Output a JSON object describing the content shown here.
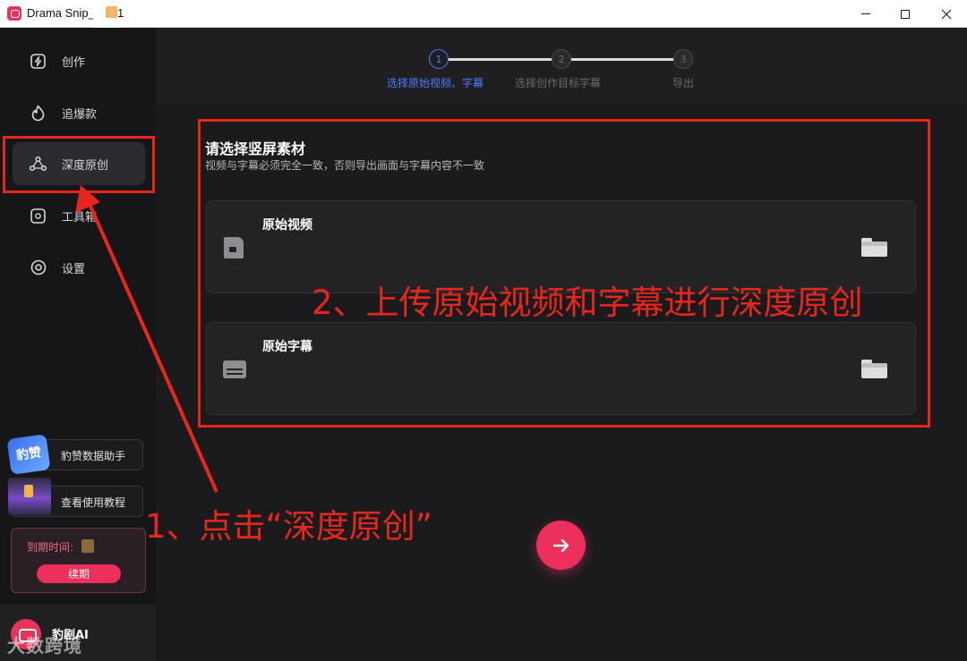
{
  "window": {
    "title": "Drama Snip_",
    "title_suffix": "1",
    "min_label": "minimize",
    "max_label": "maximize",
    "close_label": "close"
  },
  "sidebar": {
    "items": [
      {
        "label": "创作",
        "icon": "lightning-icon"
      },
      {
        "label": "追爆款",
        "icon": "flame-icon"
      },
      {
        "label": "深度原创",
        "icon": "network-icon"
      },
      {
        "label": "工具箱",
        "icon": "toolbox-icon"
      },
      {
        "label": "设置",
        "icon": "settings-icon"
      }
    ],
    "helper_label": "豹赞数据助手",
    "helper_thumb_text": "豹赞",
    "tutorial_label": "查看使用教程",
    "expire_label": "到期时间:",
    "renew_label": "续期",
    "brand_name": "豹剧AI",
    "watermark": "大数跨境"
  },
  "stepper": {
    "steps": [
      {
        "number": "1",
        "label": "选择原始视频、字幕",
        "state": "active"
      },
      {
        "number": "2",
        "label": "选择创作目标字幕",
        "state": "idle"
      },
      {
        "number": "3",
        "label": "导出",
        "state": "idle"
      }
    ]
  },
  "content": {
    "title": "请选择竖屏素材",
    "subtitle": "视频与字幕必须完全一致，否则导出画面与字幕内容不一致",
    "video_label": "原始视频",
    "subtitle_label": "原始字幕"
  },
  "annotations": {
    "step2": "2、上传原始视频和字幕进行深度原创",
    "step1": "1、点击“深度原创”"
  },
  "colors": {
    "accent": "#ec2f5c",
    "step_active": "#4a7dff",
    "annotation_red": "#e8261c"
  }
}
